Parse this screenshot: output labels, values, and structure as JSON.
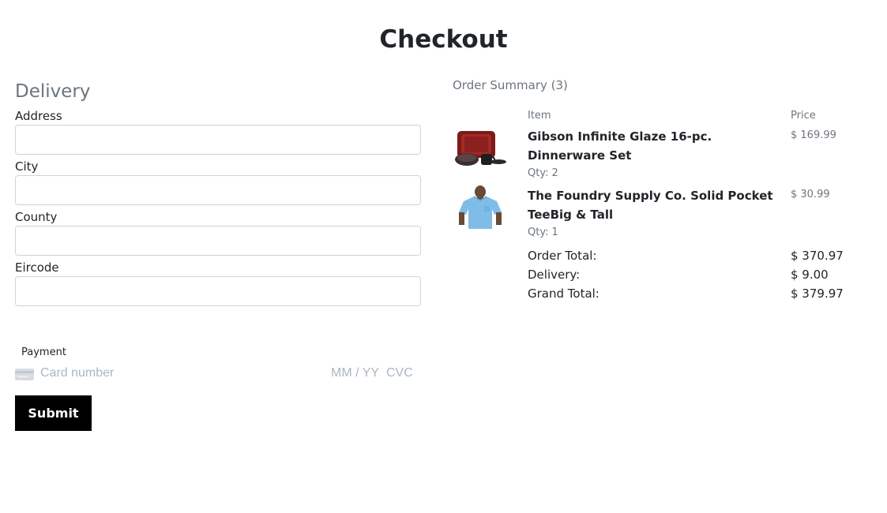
{
  "page": {
    "title": "Checkout"
  },
  "delivery": {
    "heading": "Delivery",
    "fields": [
      {
        "label": "Address",
        "value": "",
        "placeholder": ""
      },
      {
        "label": "City",
        "value": "",
        "placeholder": ""
      },
      {
        "label": "County",
        "value": "",
        "placeholder": ""
      },
      {
        "label": "Eircode",
        "value": "",
        "placeholder": ""
      }
    ]
  },
  "payment": {
    "label": "Payment",
    "card_icon": "credit-card-icon",
    "card_number_placeholder": "Card number",
    "expiry_placeholder": "MM / YY",
    "cvc_placeholder": "CVC"
  },
  "submit": {
    "label": "Submit"
  },
  "summary": {
    "title": "Order Summary (3)",
    "columns": {
      "item": "Item",
      "price": "Price"
    },
    "items": [
      {
        "name": "Gibson Infinite Glaze 16-pc. Dinnerware Set",
        "qty_label": "Qty:",
        "qty": "2",
        "price": "$ 169.99",
        "thumbnail": "dinnerware-set-image"
      },
      {
        "name": "The Foundry Supply Co. Solid Pocket TeeBig & Tall",
        "qty_label": "Qty:",
        "qty": "1",
        "price": "$ 30.99",
        "thumbnail": "blue-tshirt-image"
      }
    ],
    "totals": [
      {
        "label": "Order Total:",
        "value": "$ 370.97"
      },
      {
        "label": "Delivery:",
        "value": "$ 9.00"
      },
      {
        "label": "Grand Total:",
        "value": "$ 379.97"
      }
    ]
  },
  "colors": {
    "muted_text": "#6c757d",
    "input_border": "#ced4da",
    "button_bg": "#000000",
    "placeholder": "#aab7c4"
  }
}
